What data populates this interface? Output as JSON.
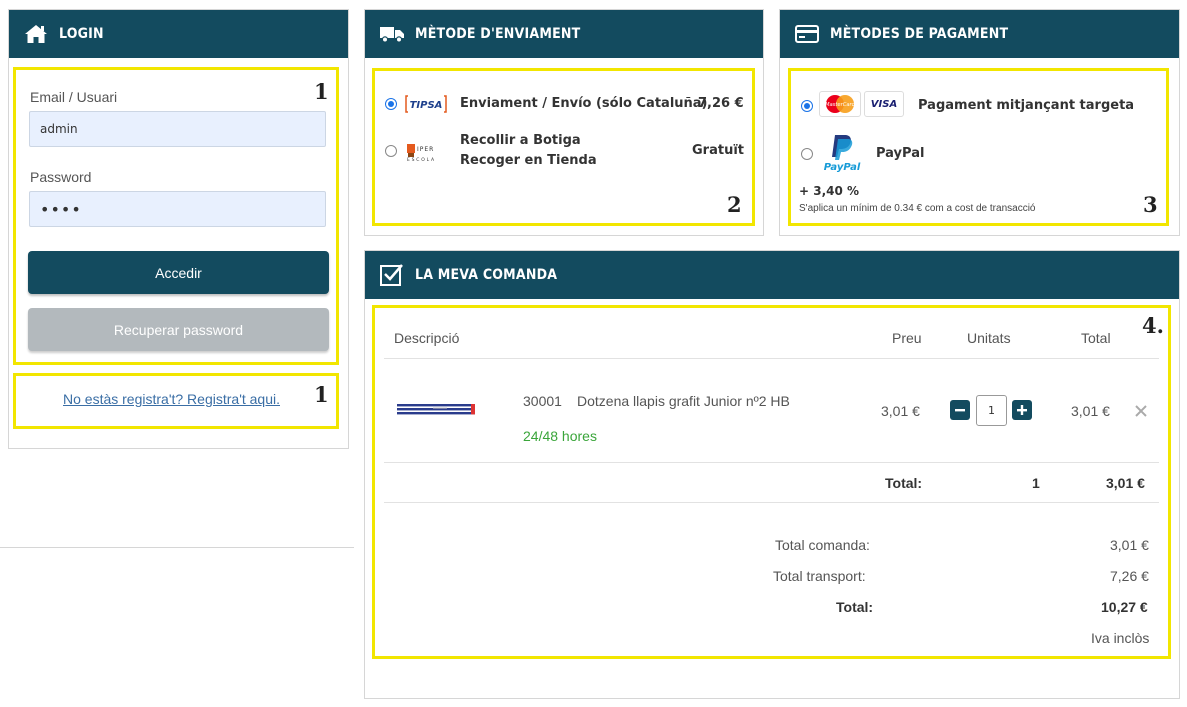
{
  "login": {
    "title": "LOGIN",
    "email_label": "Email / Usuari",
    "email_value": "admin",
    "password_label": "Password",
    "password_value": "••••",
    "submit_label": "Accedir",
    "recover_label": "Recuperar password",
    "register_link": "No estàs registra't? Registra't aqui."
  },
  "shipping": {
    "title": "MÈTODE D'ENVIAMENT",
    "options": [
      {
        "logo": "TIPSA",
        "label": "Enviament / Envío (sólo Cataluña)",
        "price": "7,26 €",
        "selected": true
      },
      {
        "logo": "IPER ESCOLA",
        "label_line1": "Recollir a Botiga",
        "label_line2": "Recoger en Tienda",
        "price": "Gratuït",
        "selected": false
      }
    ]
  },
  "payment": {
    "title": "MÈTODES DE PAGAMENT",
    "options": [
      {
        "logo1": "MasterCard",
        "logo2": "VISA",
        "label": "Pagament mitjançant targeta",
        "selected": true
      },
      {
        "logo": "PayPal",
        "label": "PayPal",
        "selected": false
      }
    ],
    "fee": "+ 3,40 %",
    "fee_note": "S'aplica un mínim de 0.34 €  com a cost de transacció"
  },
  "order": {
    "title": "LA MEVA COMANDA",
    "headers": {
      "description": "Descripció",
      "price": "Preu",
      "units": "Unitats",
      "total": "Total"
    },
    "items": [
      {
        "code": "30001",
        "name": "Dotzena llapis grafit Junior nº2 HB",
        "delivery": "24/48 hores",
        "price": "3,01 €",
        "qty": "1",
        "total": "3,01 €"
      }
    ],
    "subtotal_label": "Total:",
    "subtotal_units": "1",
    "subtotal_value": "3,01 €",
    "summary": {
      "order_total_label": "Total comanda:",
      "order_total": "3,01 €",
      "transport_label": "Total transport:",
      "transport": "7,26 €",
      "grand_label": "Total:",
      "grand": "10,27 €",
      "tax_note": "Iva inclòs"
    }
  },
  "steps": [
    "1",
    "1",
    "2",
    "3",
    "4."
  ],
  "colors": {
    "header": "#134b5f",
    "highlight": "#f2e600",
    "delivery": "#3aa53a",
    "radio": "#1a73e8"
  }
}
